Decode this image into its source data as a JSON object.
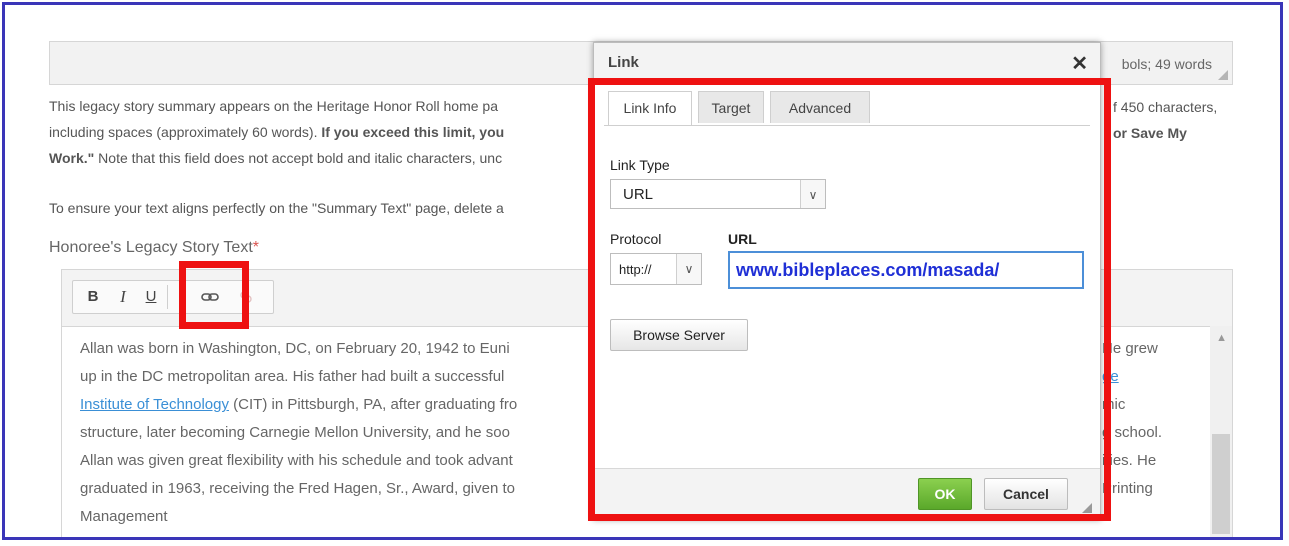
{
  "page": {
    "word_count": "bols; 49 words",
    "summary_lines": [
      "This legacy story summary appears on the Heritage Honor Roll home pa",
      "including spaces (approximately 60 words).",
      "If you exceed this limit, you",
      "Work.\"",
      "Note that this field does not accept bold and italic characters, unc",
      "To ensure your text aligns perfectly on the \"Summary Text\" page, delete a"
    ],
    "right_fragments": [
      "f 450 characters,",
      "or Save My"
    ],
    "section_label": "Honoree's Legacy Story Text",
    "required_mark": "*"
  },
  "editor": {
    "toolbar": {
      "bold": "B",
      "italic": "I",
      "underline": "U"
    },
    "story_lines": [
      "Allan was born in Washington, DC, on February 20, 1942 to Euni",
      "up in the DC metropolitan area. His father had built a successful",
      "Institute of Technology",
      "(CIT) in Pittsburgh, PA, after graduating fro",
      "structure, later becoming Carnegie Mellon University, and he soo",
      "Allan was given great flexibility with his schedule and took advant",
      "graduated in 1963, receiving the Fred Hagen, Sr., Award, given to",
      "Management"
    ],
    "story_right": [
      "He grew",
      "ge",
      "mic",
      "g school.",
      "ities. He",
      "Printing"
    ]
  },
  "dialog": {
    "title": "Link",
    "close": "✕",
    "tabs": [
      "Link Info",
      "Target",
      "Advanced"
    ],
    "link_type_label": "Link Type",
    "link_type_value": "URL",
    "protocol_label": "Protocol",
    "protocol_value": "http://",
    "url_label": "URL",
    "url_value": "www.bibleplaces.com/masada/",
    "browse_label": "Browse Server",
    "ok_label": "OK",
    "cancel_label": "Cancel"
  },
  "colors": {
    "frame_border": "#3a35b8",
    "highlight_red": "#ee1111",
    "ok_green": "#5aa82a",
    "link_blue": "#3a8fd6",
    "url_text": "#1f2fd6"
  }
}
